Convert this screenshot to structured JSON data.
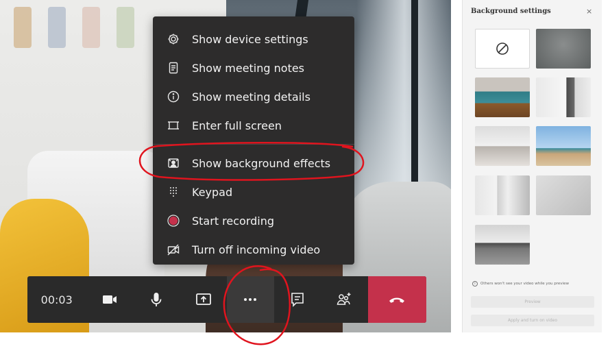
{
  "menu": {
    "items": [
      {
        "label": "Show device settings",
        "icon": "gear-icon"
      },
      {
        "label": "Show meeting notes",
        "icon": "notes-icon"
      },
      {
        "label": "Show meeting details",
        "icon": "info-icon"
      },
      {
        "label": "Enter full screen",
        "icon": "fullscreen-icon"
      },
      {
        "label": "Show background effects",
        "icon": "background-effects-icon"
      },
      {
        "label": "Keypad",
        "icon": "keypad-icon"
      },
      {
        "label": "Start recording",
        "icon": "record-icon"
      },
      {
        "label": "Turn off incoming video",
        "icon": "video-off-icon"
      }
    ]
  },
  "controls": {
    "timer": "00:03",
    "icons": [
      "camera-icon",
      "microphone-icon",
      "share-screen-icon",
      "more-options-icon",
      "chat-icon",
      "participants-icon",
      "hang-up-icon"
    ]
  },
  "colors": {
    "menu_bg": "#2d2c2c",
    "control_bar_bg": "#2a2a2a",
    "hang_up": "#c4314b",
    "record": "#c4314b",
    "annotation": "#e0141e",
    "panel_bg": "#f4f4f4"
  },
  "panel": {
    "title": "Background settings",
    "close": "×",
    "info": "Others won't see your video while you preview",
    "preview_button": "Preview",
    "apply_button": "Apply and turn on video"
  }
}
